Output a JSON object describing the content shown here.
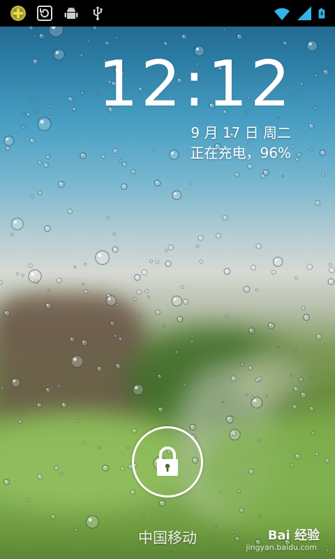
{
  "status_bar": {
    "left_icons": [
      "plus-app-icon",
      "sync-icon",
      "android-debug-icon",
      "usb-icon"
    ],
    "right_icons": [
      "wifi-icon",
      "signal-icon",
      "battery-charging-icon"
    ]
  },
  "lockscreen": {
    "time": "12:12",
    "date": "9 月 17 日 周二",
    "charging_status": "正在充电，96%",
    "carrier": "中国移动"
  },
  "watermark": {
    "brand": "Bai 经验",
    "url": "jingyan.baidu.com"
  },
  "colors": {
    "status_bar_bg": "#000000",
    "text": "#ffffff",
    "wifi_accent": "#33b5e5"
  }
}
